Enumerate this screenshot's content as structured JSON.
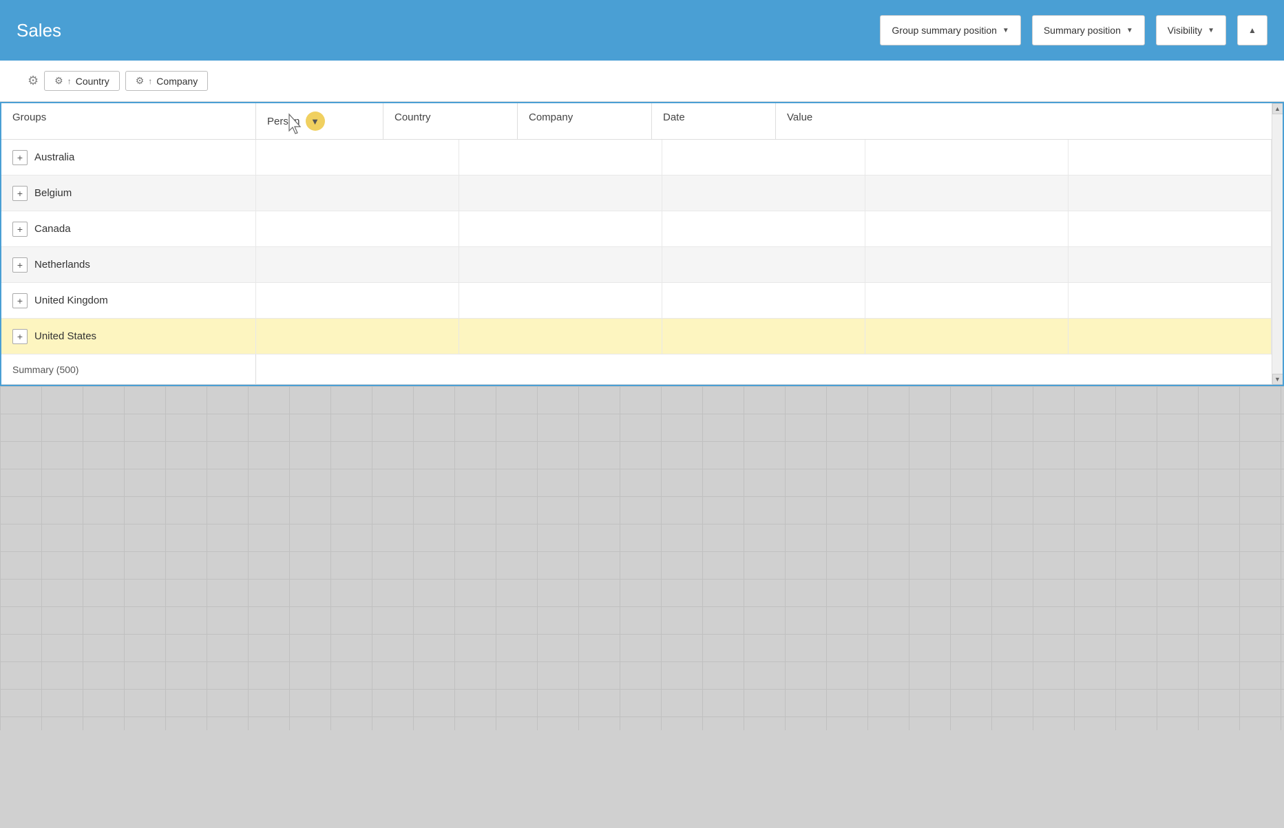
{
  "header": {
    "title": "Sales",
    "group_summary_btn": "Group summary position",
    "summary_btn": "Summary position",
    "visibility_btn": "Visibility"
  },
  "group_pills": [
    {
      "id": "country",
      "label": "Country"
    },
    {
      "id": "company",
      "label": "Company"
    }
  ],
  "table": {
    "columns": {
      "groups": "Groups",
      "person": "Person",
      "country": "Country",
      "company": "Company",
      "date": "Date",
      "value": "Value"
    },
    "rows": [
      {
        "label": "Australia",
        "highlighted": false
      },
      {
        "label": "Belgium",
        "highlighted": false
      },
      {
        "label": "Canada",
        "highlighted": false
      },
      {
        "label": "Netherlands",
        "highlighted": false
      },
      {
        "label": "United Kingdom",
        "highlighted": false
      },
      {
        "label": "United States",
        "highlighted": true
      }
    ],
    "summary": "Summary (500)"
  }
}
